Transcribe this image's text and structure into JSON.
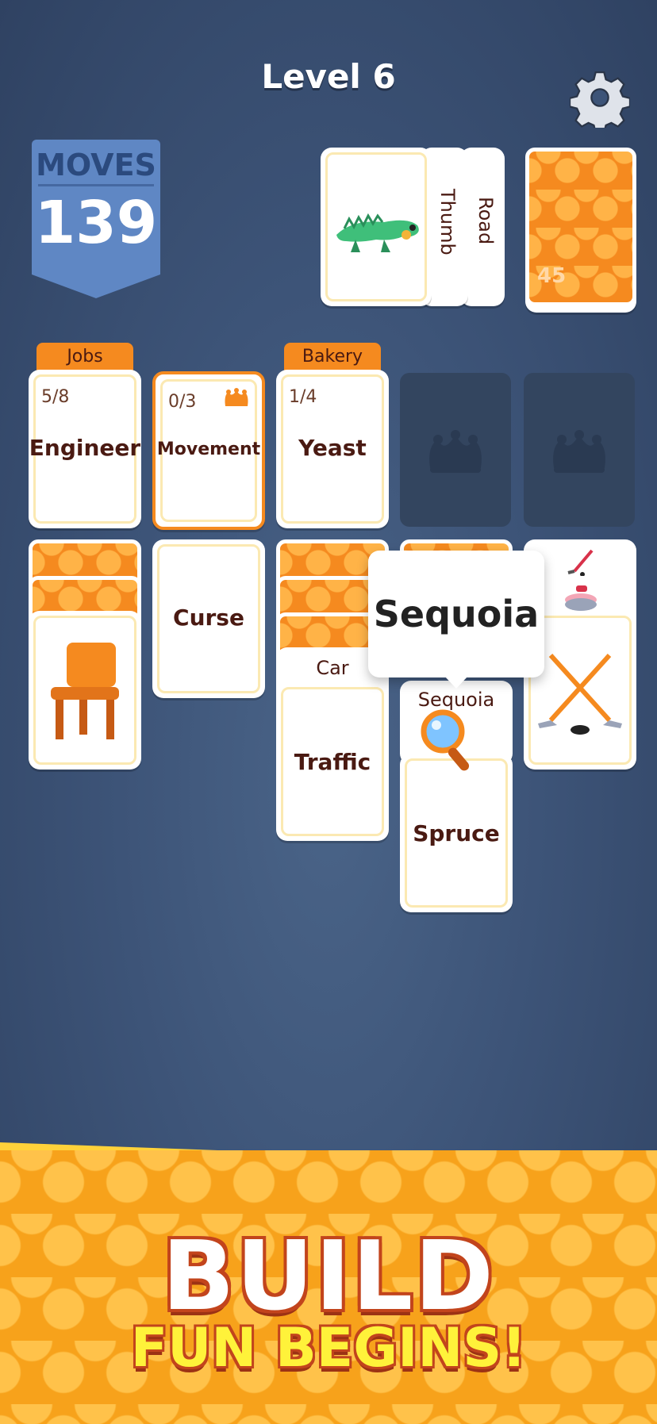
{
  "header": {
    "level_title": "Level 6",
    "settings_icon": "gear-icon"
  },
  "moves": {
    "label": "MOVES",
    "value": "139"
  },
  "top_row": {
    "active_card_icon": "iguana-icon",
    "fanned_words": [
      "Thumb",
      "Road"
    ],
    "deck_count": "45"
  },
  "categories": [
    {
      "tab": "Jobs",
      "count": "5/8",
      "word": "Engineer"
    },
    {
      "tab": "",
      "count": "0/3",
      "word": "Movement",
      "icon": "jester-hat-icon"
    },
    {
      "tab": "Bakery",
      "count": "1/4",
      "word": "Yeast"
    }
  ],
  "empty_slots": [
    "jester-hat-icon",
    "jester-hat-icon"
  ],
  "columns": {
    "col1_card_icon": "chair-icon",
    "col2_word": "Curse",
    "col3_tab_word": "Car",
    "col3_word": "Traffic",
    "col4_under_word": "Sequoia",
    "col4_word": "Spruce",
    "col5_icons": [
      "hockey-stick-icon",
      "curling-stone-icon",
      "crossed-hockey-sticks-icon"
    ]
  },
  "tooltip": {
    "text": "Sequoia",
    "hint_icon": "magnifier-icon"
  },
  "banner": {
    "line1": "BUILD",
    "line2": "FUN BEGINS!"
  },
  "colors": {
    "background": "#3d5478",
    "card_orange": "#f58a1f",
    "text_brown": "#4a1a12",
    "banner_yellow": "#fff23a"
  }
}
